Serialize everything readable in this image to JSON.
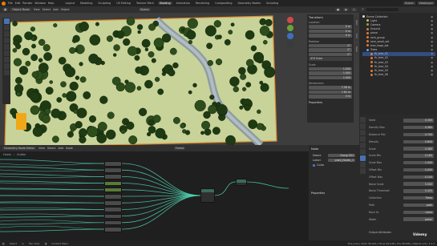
{
  "topbar": {
    "menus": [
      "File",
      "Edit",
      "Render",
      "Window",
      "Help"
    ],
    "workspaces": [
      "Layout",
      "Modeling",
      "Sculpting",
      "UV Editing",
      "Texture Paint",
      "Shading",
      "Animation",
      "Rendering",
      "Compositing",
      "Geometry Nodes",
      "Scripting"
    ],
    "active_workspace": "Shading",
    "scene_label": "Scene",
    "viewlayer_label": "ViewLayer"
  },
  "viewport": {
    "mode": "Object Mode",
    "menus": [
      "View",
      "Select",
      "Add",
      "Object"
    ],
    "transform_orientation": "Global"
  },
  "npanel": {
    "title": "Transform",
    "location_label": "Location",
    "location": [
      "0 m",
      "0 m",
      "0 m"
    ],
    "rotation_label": "Rotation",
    "rotation": [
      "0°",
      "0°",
      "0°"
    ],
    "mode_label": "XYZ Euler",
    "scale_label": "Scale",
    "scale": [
      "1.000",
      "1.000",
      "1.000"
    ],
    "dimensions_label": "Dimensions",
    "dimensions": [
      "7.58 m",
      "7.62 m",
      "0 m"
    ],
    "properties_label": "Properties",
    "tabs": [
      "Item",
      "Tool",
      "View"
    ]
  },
  "outliner": {
    "title": "Scene Collection",
    "rows": [
      {
        "label": "Scene Collection",
        "color": "#e0e0e0",
        "selected": false
      },
      {
        "label": "Light",
        "color": "#d9b84a",
        "selected": false
      },
      {
        "label": "Camera",
        "color": "#76b04f",
        "selected": false
      },
      {
        "label": "Ground",
        "color": "#e07a3a",
        "selected": false
      },
      {
        "label": "plane",
        "color": "#e07a3a",
        "selected": false
      },
      {
        "label": "rock_group",
        "color": "#e07a3a",
        "selected": false
      },
      {
        "label": "rock_small_set",
        "color": "#e07a3a",
        "selected": false
      },
      {
        "label": "tree_large_set",
        "color": "#e07a3a",
        "selected": false
      },
      {
        "label": "Trees",
        "color": "#6aa3d8",
        "selected": false
      },
      {
        "label": "fir_tree_01",
        "color": "#e07a3a",
        "selected": true
      },
      {
        "label": "fir_tree_02",
        "color": "#e07a3a",
        "selected": false
      },
      {
        "label": "fir_tree_03",
        "color": "#e07a3a",
        "selected": false
      },
      {
        "label": "fir_tree_04",
        "color": "#e07a3a",
        "selected": false
      },
      {
        "label": "fir_tree_05",
        "color": "#e07a3a",
        "selected": false
      },
      {
        "label": "fir_tree_06",
        "color": "#e07a3a",
        "selected": false
      }
    ]
  },
  "modifier_panel": {
    "rows": [
      {
        "label": "Seed",
        "value": "0.300"
      },
      {
        "label": "Density Max",
        "value": "0.380"
      },
      {
        "label": "Distance Min",
        "value": "0.700"
      },
      {
        "label": "Density",
        "value": "0.850"
      },
      {
        "label": "Scale",
        "value": "0.360"
      },
      {
        "label": "Scale Min",
        "value": "0.160"
      },
      {
        "label": "Scale Max",
        "value": "1.000"
      },
      {
        "label": "Offset Min",
        "value": "0.000"
      },
      {
        "label": "Offset Max",
        "value": "0.100"
      },
      {
        "label": "Noise Scale",
        "value": "5.000"
      },
      {
        "label": "Noise Threshold",
        "value": "0.420"
      },
      {
        "label": "Collection",
        "value": "Trees"
      },
      {
        "label": "Path",
        "value": "path"
      },
      {
        "label": "Rock Sz",
        "value": "rocks"
      },
      {
        "label": "Water",
        "value": "water"
      }
    ],
    "footer": "Output Attributes"
  },
  "node_editor": {
    "menus": [
      "View",
      "Select",
      "Add",
      "Node"
    ],
    "editor_type": "Geometry Node Editor",
    "tree_name": "Forest",
    "breadcrumb": [
      "Forest",
      "Scatter"
    ]
  },
  "node_sidebar": {
    "title": "Node",
    "name_label": "Name",
    "name_value": "Group 001",
    "label_label": "Label",
    "label_value": "plant_Nodes_1",
    "color_label": "Color",
    "properties_label": "Properties",
    "tabs": [
      "Node",
      "Tool",
      "View",
      "Group"
    ]
  },
  "status_bar": {
    "items": [
      "Select",
      "Pan View",
      "Context Menu"
    ],
    "stats": "Tree_tree | Verts 36,024 | Faces 49,048 | Tris 98,996 | Objects 1/4 | 3.3.1"
  },
  "watermark": "Udemy",
  "colors": {
    "accent": "#4772b3",
    "ground": "#c8d39a",
    "tree_dark": "#1e3a12",
    "noodle": "#4fd1b0"
  }
}
